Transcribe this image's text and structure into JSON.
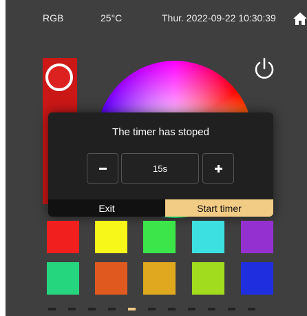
{
  "status_bar": {
    "mode": "RGB",
    "temperature": "25°C",
    "datetime": "Thur. 2022-09-22 10:30:39",
    "home_icon": "home-icon"
  },
  "controls": {
    "power_icon": "power-icon",
    "red_channel_level": 0.95
  },
  "dialog": {
    "title": "The timer has stoped",
    "value": "15s",
    "exit_label": "Exit",
    "start_label": "Start timer",
    "accent_color": "#f2cb85"
  },
  "swatches": [
    {
      "color": "#f21f1f"
    },
    {
      "color": "#f7f71a"
    },
    {
      "color": "#3ce64a"
    },
    {
      "color": "#3de0e0"
    },
    {
      "color": "#9530d0"
    },
    {
      "color": "#26d67f"
    },
    {
      "color": "#e05a1f"
    },
    {
      "color": "#e0a81f"
    },
    {
      "color": "#a2dc1f"
    },
    {
      "color": "#1f2fe0"
    }
  ],
  "pagination": {
    "count": 11,
    "active": 4
  }
}
